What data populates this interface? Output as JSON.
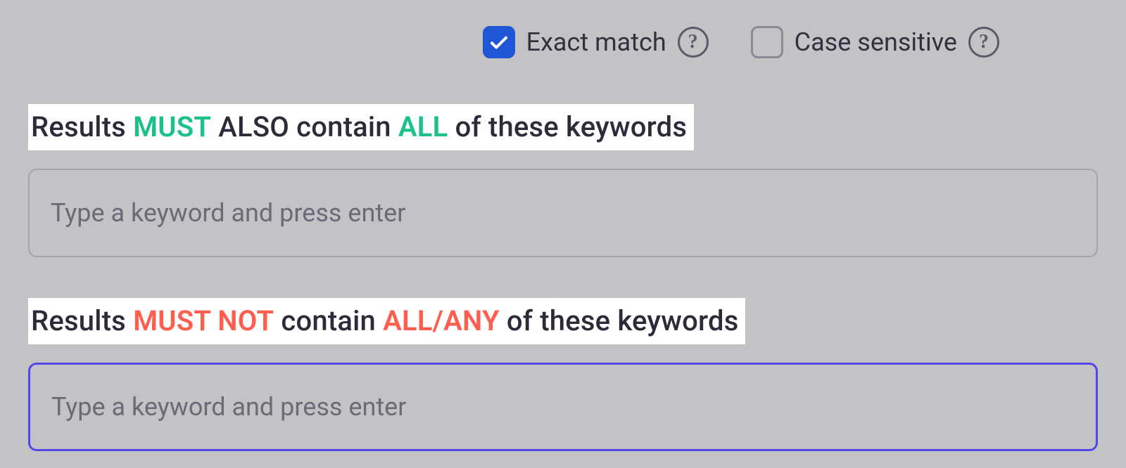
{
  "options": {
    "exact_match": {
      "label": "Exact match",
      "checked": true
    },
    "case_sensitive": {
      "label": "Case sensitive",
      "checked": false
    }
  },
  "sections": {
    "must_all": {
      "heading": {
        "p1": "Results ",
        "p2": "MUST",
        "p3": " ALSO contain ",
        "p4": "ALL",
        "p5": " of these keywords"
      },
      "placeholder": "Type a keyword and press enter",
      "value": ""
    },
    "must_not": {
      "heading": {
        "p1": "Results ",
        "p2": "MUST NOT",
        "p3": " contain ",
        "p4": "ALL/ANY",
        "p5": " of these keywords"
      },
      "placeholder": "Type a keyword and press enter",
      "value": ""
    }
  },
  "colors": {
    "accent_blue": "#1e56d6",
    "focus_purple": "#5546e8",
    "green": "#1cc08a",
    "red": "#fd5e4e",
    "bg": "#c3c3c5"
  }
}
